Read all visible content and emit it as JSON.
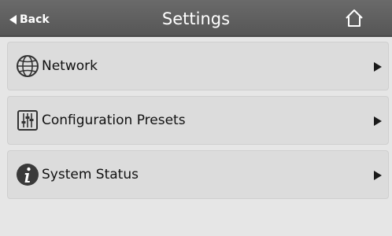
{
  "header": {
    "back_label": "Back",
    "title": "Settings",
    "home_icon": "home-icon"
  },
  "menu": {
    "items": [
      {
        "label": "Network",
        "icon": "globe-icon"
      },
      {
        "label": "Configuration Presets",
        "icon": "sliders-icon"
      },
      {
        "label": "System Status",
        "icon": "info-icon"
      }
    ]
  },
  "colors": {
    "header_bg": "#5f5f5f",
    "page_bg": "#e6e6e6",
    "row_bg": "#dcdcdc"
  }
}
